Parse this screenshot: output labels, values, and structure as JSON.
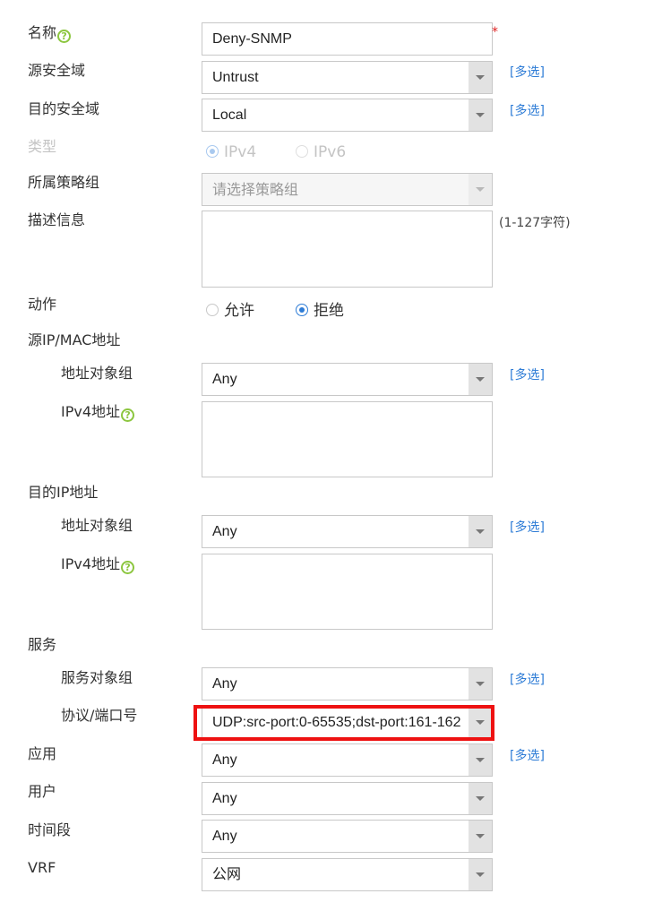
{
  "form": {
    "name": {
      "label": "名称",
      "value": "Deny-SNMP",
      "required_mark": "*"
    },
    "src_zone": {
      "label": "源安全域",
      "value": "Untrust",
      "multi": "[多选]"
    },
    "dst_zone": {
      "label": "目的安全域",
      "value": "Local",
      "multi": "[多选]"
    },
    "type": {
      "label": "类型",
      "options": [
        "IPv4",
        "IPv6"
      ],
      "selected": "IPv4"
    },
    "policy_group": {
      "label": "所属策略组",
      "placeholder": "请选择策略组"
    },
    "description": {
      "label": "描述信息",
      "hint": "(1-127字符)"
    },
    "action": {
      "label": "动作",
      "options": [
        "允许",
        "拒绝"
      ],
      "selected": "拒绝"
    },
    "src_ip": {
      "label": "源IP/MAC地址",
      "addr_group_label": "地址对象组",
      "addr_group_value": "Any",
      "multi": "[多选]",
      "ipv4_label": "IPv4地址"
    },
    "dst_ip": {
      "label": "目的IP地址",
      "addr_group_label": "地址对象组",
      "addr_group_value": "Any",
      "multi": "[多选]",
      "ipv4_label": "IPv4地址"
    },
    "service": {
      "label": "服务",
      "group_label": "服务对象组",
      "group_value": "Any",
      "multi": "[多选]",
      "proto_label": "协议/端口号",
      "proto_value": "UDP:src-port:0-65535;dst-port:161-162"
    },
    "application": {
      "label": "应用",
      "value": "Any",
      "multi": "[多选]"
    },
    "user": {
      "label": "用户",
      "value": "Any"
    },
    "time_range": {
      "label": "时间段",
      "value": "Any"
    },
    "vrf": {
      "label": "VRF",
      "value": "公网"
    }
  },
  "icons": {
    "help": "question-circle-icon",
    "dropdown": "chevron-down-icon"
  },
  "colors": {
    "help_icon": "#8cc63f",
    "link": "#2e7cd6",
    "required": "#e02020",
    "highlight_box": "#ee1111"
  }
}
